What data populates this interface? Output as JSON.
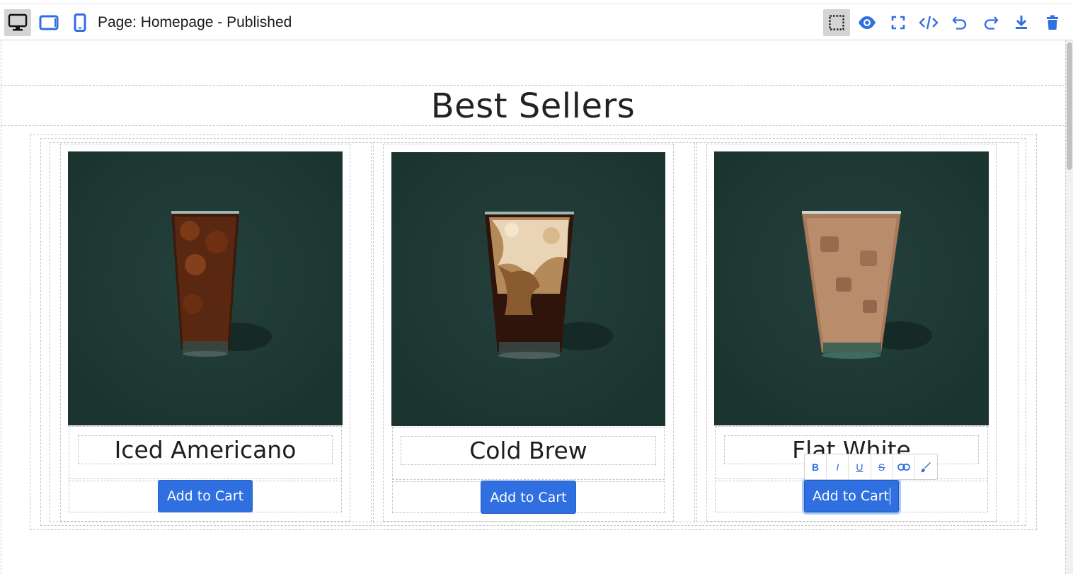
{
  "toolbar": {
    "page_label": "Page: Homepage - Published",
    "devices": [
      {
        "name": "desktop",
        "icon": "desktop-icon",
        "active": true
      },
      {
        "name": "tablet",
        "icon": "tablet-icon",
        "active": false
      },
      {
        "name": "mobile",
        "icon": "mobile-icon",
        "active": false
      }
    ],
    "actions": [
      {
        "name": "show-borders",
        "icon": "dashed-square-icon",
        "active": true
      },
      {
        "name": "preview",
        "icon": "eye-icon"
      },
      {
        "name": "fullscreen",
        "icon": "fullscreen-icon"
      },
      {
        "name": "code",
        "icon": "code-icon"
      },
      {
        "name": "undo",
        "icon": "undo-icon"
      },
      {
        "name": "redo",
        "icon": "redo-icon"
      },
      {
        "name": "download",
        "icon": "download-icon"
      },
      {
        "name": "delete",
        "icon": "trash-icon"
      }
    ]
  },
  "section": {
    "title": "Best Sellers"
  },
  "products": [
    {
      "name": "Iced Americano",
      "button": "Add to Cart",
      "image": "iced-americano-image"
    },
    {
      "name": "Cold Brew",
      "button": "Add to Cart",
      "image": "cold-brew-image"
    },
    {
      "name": "Flat White",
      "button": "Add to Cart",
      "image": "flat-white-image"
    }
  ],
  "rte_toolbar": {
    "bold": "B",
    "italic": "I",
    "underline": "U",
    "strike": "S",
    "link_icon": "link-icon",
    "brush_icon": "brush-icon"
  },
  "colors": {
    "accent": "#2f6fe0",
    "image_bg": "#1f3834",
    "icon_blue": "#2f6fe0"
  }
}
